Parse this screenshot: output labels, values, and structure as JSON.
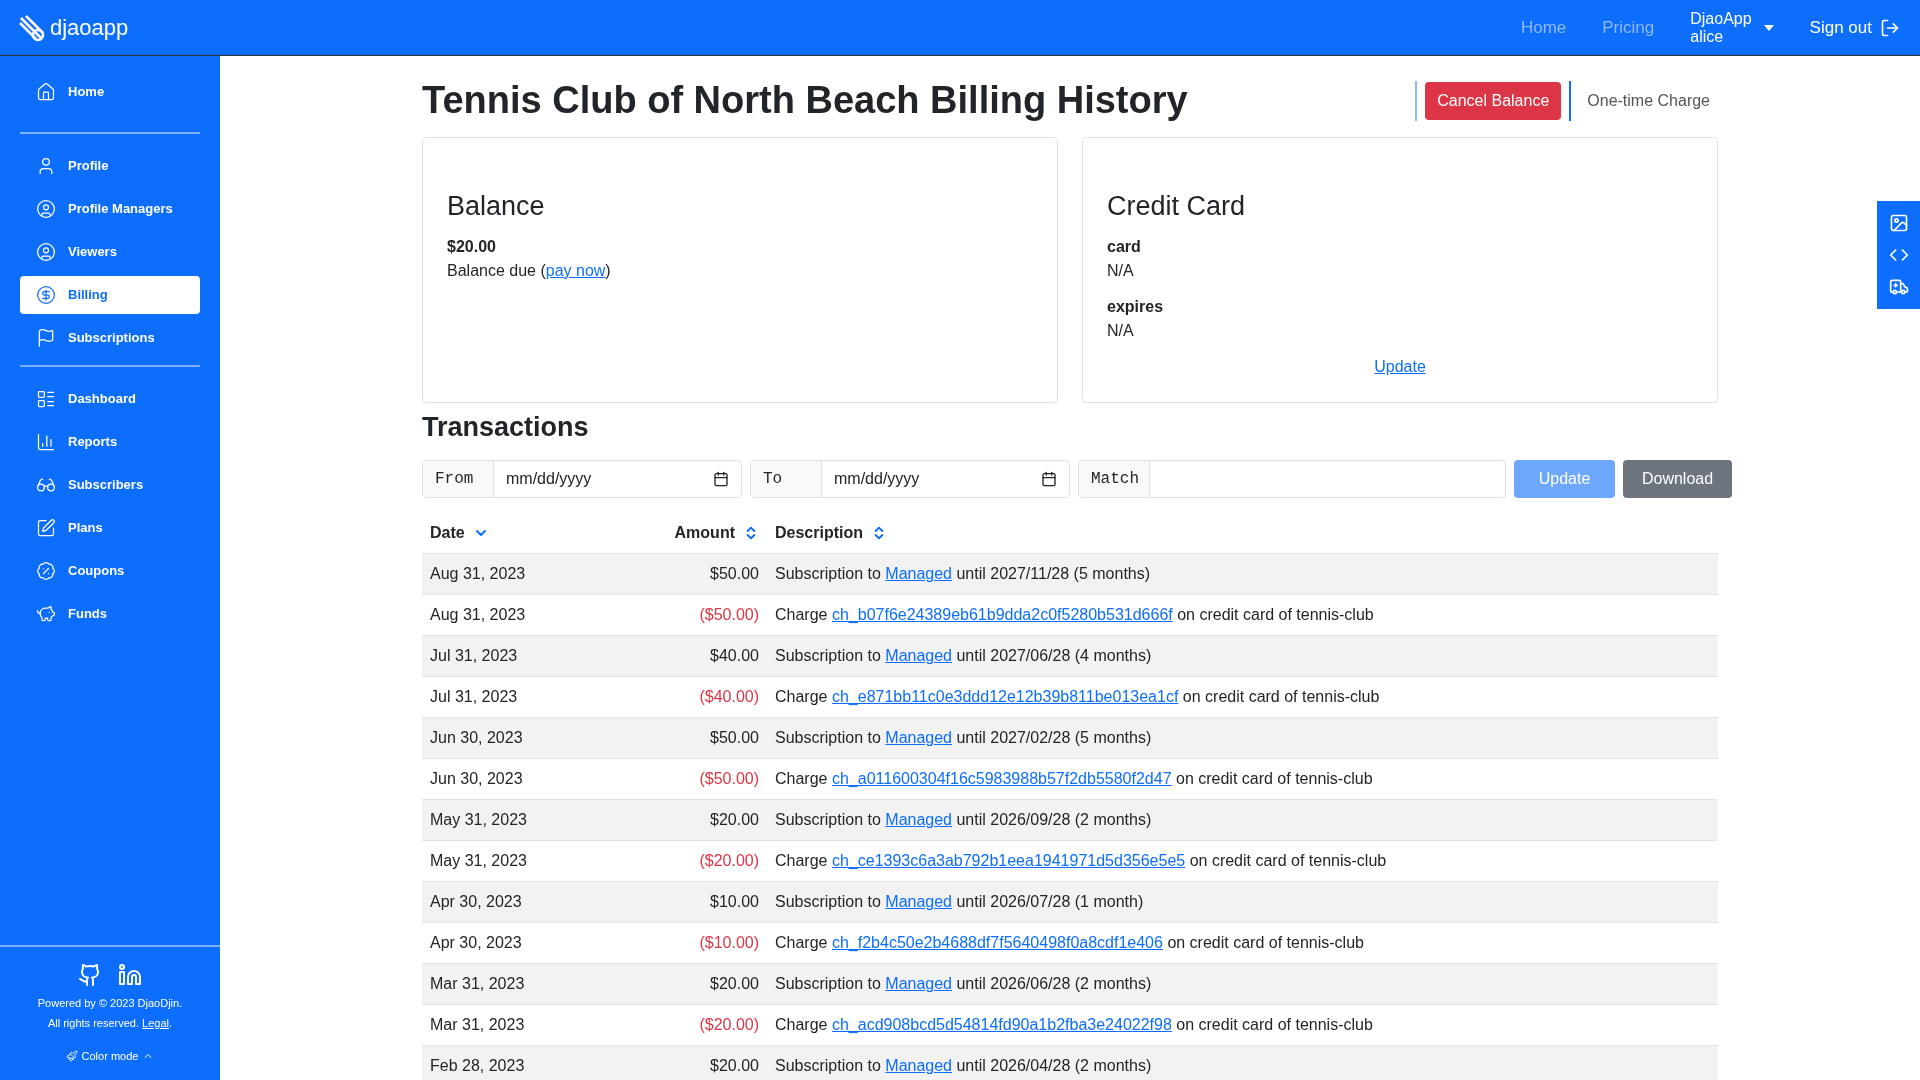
{
  "brand": "djaoapp",
  "topnav": {
    "links": [
      "Home",
      "Pricing"
    ],
    "account": {
      "name": "DjaoApp",
      "user": "alice"
    },
    "signout": "Sign out"
  },
  "sidebar": {
    "groups": [
      [
        {
          "label": "Home",
          "selected": false
        }
      ],
      [
        {
          "label": "Profile",
          "selected": false
        },
        {
          "label": "Profile Managers",
          "selected": false
        },
        {
          "label": "Viewers",
          "selected": false
        },
        {
          "label": "Billing",
          "selected": true
        },
        {
          "label": "Subscriptions",
          "selected": false
        }
      ],
      [
        {
          "label": "Dashboard",
          "selected": false
        },
        {
          "label": "Reports",
          "selected": false
        },
        {
          "label": "Subscribers",
          "selected": false
        },
        {
          "label": "Plans",
          "selected": false
        },
        {
          "label": "Coupons",
          "selected": false
        },
        {
          "label": "Funds",
          "selected": false
        }
      ]
    ],
    "footer": {
      "powered": "Powered by © 2023 DjaoDjin.",
      "rights": "All rights reserved.",
      "legal": "Legal",
      "legal_after": ".",
      "color_mode": "Color mode"
    }
  },
  "page": {
    "title": "Tennis Club of North Beach Billing History",
    "actions": {
      "cancel": "Cancel Balance",
      "charge": "One-time Charge"
    }
  },
  "balance": {
    "title": "Balance",
    "amount": "$20.00",
    "due": "Balance due (",
    "link": "pay now",
    "after": ")"
  },
  "credit_card": {
    "title": "Credit Card",
    "fields": [
      {
        "label": "card",
        "value": "N/A"
      },
      {
        "label": "expires",
        "value": "N/A"
      }
    ],
    "update": "Update"
  },
  "transactions": {
    "title": "Transactions",
    "filters": [
      {
        "label": "From",
        "placeholder": "mm/dd/yyyy",
        "kind": "date"
      },
      {
        "label": "To",
        "placeholder": "mm/dd/yyyy",
        "kind": "date"
      },
      {
        "label": "Match",
        "kind": "text"
      }
    ],
    "buttons": [
      "Update",
      "Download"
    ],
    "columns": [
      {
        "label": "Date",
        "sorted": true
      },
      {
        "label": "Amount",
        "sorted": false
      },
      {
        "label": "Description",
        "sorted": false
      }
    ],
    "rows": [
      {
        "date": "Aug 31, 2023",
        "amount": "$50.00",
        "kind": "credit",
        "before": "Subscription to",
        "link": "Managed",
        "after": "until 2027/11/28 (5 months)"
      },
      {
        "date": "Aug 31, 2023",
        "amount": "($50.00)",
        "kind": "debit",
        "before": "Charge",
        "link": "ch_b07f6e24389eb61b9dda2c0f5280b531d666f",
        "after": "on credit card of tennis-club"
      },
      {
        "date": "Jul 31, 2023",
        "amount": "$40.00",
        "kind": "credit",
        "before": "Subscription to",
        "link": "Managed",
        "after": "until 2027/06/28 (4 months)"
      },
      {
        "date": "Jul 31, 2023",
        "amount": "($40.00)",
        "kind": "debit",
        "before": "Charge",
        "link": "ch_e871bb11c0e3ddd12e12b39b811be013ea1cf",
        "after": "on credit card of tennis-club"
      },
      {
        "date": "Jun 30, 2023",
        "amount": "$50.00",
        "kind": "credit",
        "before": "Subscription to",
        "link": "Managed",
        "after": "until 2027/02/28 (5 months)"
      },
      {
        "date": "Jun 30, 2023",
        "amount": "($50.00)",
        "kind": "debit",
        "before": "Charge",
        "link": "ch_a011600304f16c5983988b57f2db5580f2d47",
        "after": "on credit card of tennis-club"
      },
      {
        "date": "May 31, 2023",
        "amount": "$20.00",
        "kind": "credit",
        "before": "Subscription to",
        "link": "Managed",
        "after": "until 2026/09/28 (2 months)"
      },
      {
        "date": "May 31, 2023",
        "amount": "($20.00)",
        "kind": "debit",
        "before": "Charge",
        "link": "ch_ce1393c6a3ab792b1eea1941971d5d356e5e5",
        "after": "on credit card of tennis-club"
      },
      {
        "date": "Apr 30, 2023",
        "amount": "$10.00",
        "kind": "credit",
        "before": "Subscription to",
        "link": "Managed",
        "after": "until 2026/07/28 (1 month)"
      },
      {
        "date": "Apr 30, 2023",
        "amount": "($10.00)",
        "kind": "debit",
        "before": "Charge",
        "link": "ch_f2b4c50e2b4688df7f5640498f0a8cdf1e406",
        "after": "on credit card of tennis-club"
      },
      {
        "date": "Mar 31, 2023",
        "amount": "$20.00",
        "kind": "credit",
        "before": "Subscription to",
        "link": "Managed",
        "after": "until 2026/06/28 (2 months)"
      },
      {
        "date": "Mar 31, 2023",
        "amount": "($20.00)",
        "kind": "debit",
        "before": "Charge",
        "link": "ch_acd908bcd5d54814fd90a1b2fba3e24022f98",
        "after": "on credit card of tennis-club"
      },
      {
        "date": "Feb 28, 2023",
        "amount": "$20.00",
        "kind": "credit",
        "before": "Subscription to",
        "link": "Managed",
        "after": "until 2026/04/28 (2 months)"
      }
    ]
  }
}
